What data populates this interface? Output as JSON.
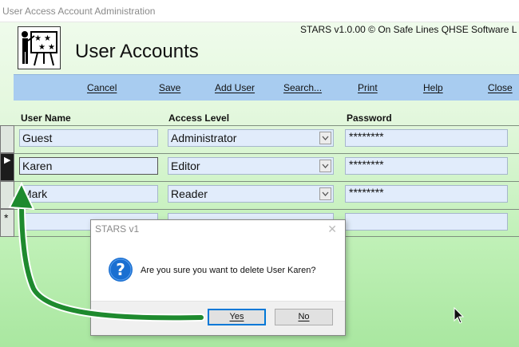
{
  "window": {
    "title": "User Access Account Administration"
  },
  "header": {
    "heading": "User Accounts",
    "copyright": "STARS v1.0.00 © On Safe Lines QHSE Software L"
  },
  "toolbar": {
    "cancel": "Cancel",
    "save": "Save",
    "add_user": "Add User",
    "search": "Search...",
    "print": "Print",
    "help": "Help",
    "close": "Close"
  },
  "table": {
    "columns": [
      "User Name",
      "Access Level",
      "Password"
    ],
    "rows": [
      {
        "user": "Guest",
        "level": "Administrator",
        "password": "********"
      },
      {
        "user": "Karen",
        "level": "Editor",
        "password": "********"
      },
      {
        "user": "Mark",
        "level": "Reader",
        "password": "********"
      }
    ],
    "new_row_marker": "*",
    "current_row_marker": "▶"
  },
  "dialog": {
    "title": "STARS v1",
    "message": "Are you sure you want to delete User Karen?",
    "yes": "Yes",
    "no": "No",
    "icon": "question-icon"
  },
  "colors": {
    "toolbar": "#a8ccf0",
    "field": "#e1ecfb",
    "annotation_arrow": "#1e8a2e",
    "dialog_icon": "#1a6fd1"
  },
  "icons": {
    "logo": "presenter-chart-icon",
    "dropdown": "chevron-down-icon",
    "cursor": "mouse-pointer-icon"
  }
}
